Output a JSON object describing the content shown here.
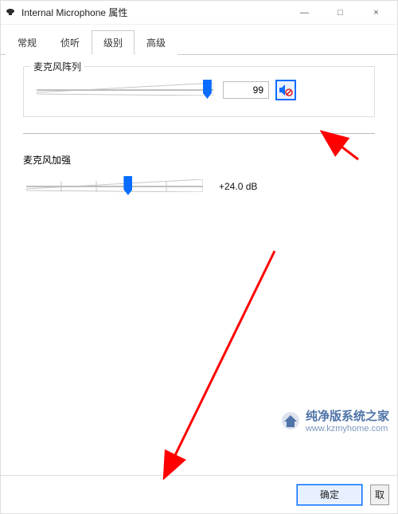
{
  "window": {
    "title": "Internal Microphone 属性",
    "close": "×",
    "max": "□",
    "min": "—"
  },
  "tabs": [
    {
      "label": "常规",
      "active": false
    },
    {
      "label": "侦听",
      "active": false
    },
    {
      "label": "级别",
      "active": true
    },
    {
      "label": "高级",
      "active": false
    }
  ],
  "mic_array": {
    "label": "麦克风阵列",
    "value": "99",
    "slider_percent": 99,
    "muted": true
  },
  "mic_boost": {
    "label": "麦克风加强",
    "value": "+24.0 dB",
    "slider_percent": 58
  },
  "buttons": {
    "ok": "确定",
    "cancel": "取"
  },
  "watermark": {
    "name": "纯净版系统之家",
    "url": "www.kzmyhome.com"
  }
}
